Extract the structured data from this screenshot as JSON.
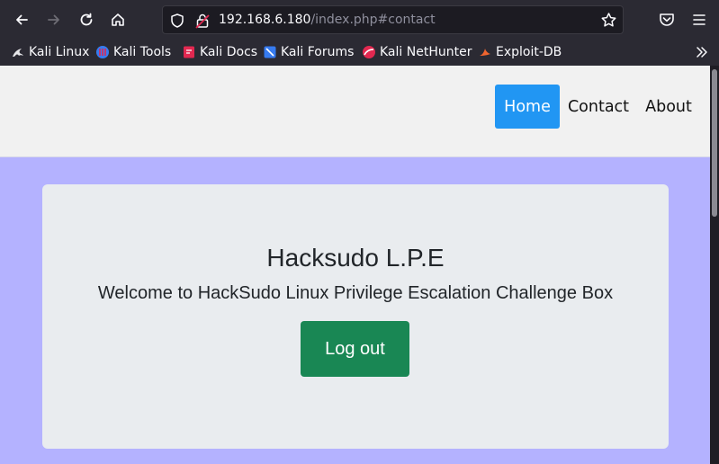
{
  "browser": {
    "url_host": "192.168.6.180",
    "url_path": "/index.php#contact"
  },
  "bookmarks": [
    {
      "label": "Kali Linux",
      "icon": "kali-dragon-icon"
    },
    {
      "label": "Kali Tools",
      "icon": "kali-tools-icon"
    },
    {
      "label": "Kali Docs",
      "icon": "kali-docs-icon"
    },
    {
      "label": "Kali Forums",
      "icon": "kali-forums-icon"
    },
    {
      "label": "Kali NetHunter",
      "icon": "kali-nethunter-icon"
    },
    {
      "label": "Exploit-DB",
      "icon": "exploit-db-icon"
    }
  ],
  "site": {
    "nav": {
      "home": "Home",
      "contact": "Contact",
      "about": "About"
    },
    "card": {
      "title": "Hacksudo L.P.E",
      "subtitle": "Welcome to HackSudo Linux Privilege Escalation Challenge Box",
      "logout_label": "Log out"
    }
  },
  "colors": {
    "page_background": "#b4b2ff",
    "nav_active": "#2196f3",
    "logout_button": "#198754",
    "card_background": "#e9ecef"
  }
}
